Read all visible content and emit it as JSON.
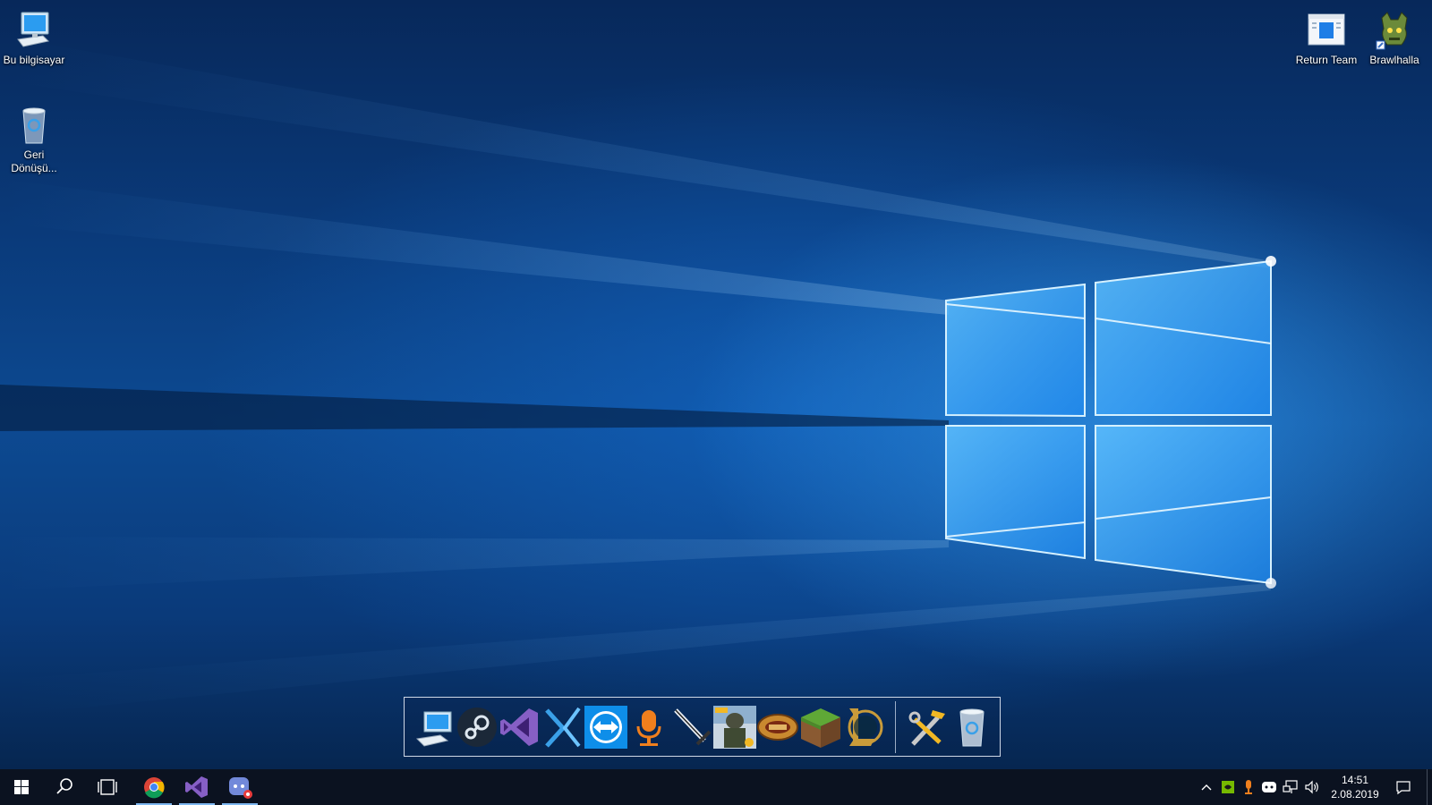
{
  "desktop": {
    "icons_left": [
      {
        "label": "Bu bilgisayar",
        "icon": "this-pc-icon"
      },
      {
        "label": "Geri Dönüşü...",
        "icon": "recycle-bin-icon"
      }
    ],
    "icons_right": [
      {
        "label": "Return Team",
        "icon": "window-app-icon"
      },
      {
        "label": "Brawlhalla",
        "icon": "brawlhalla-icon"
      }
    ]
  },
  "dock": {
    "items": [
      {
        "icon": "computer-icon"
      },
      {
        "icon": "steam-icon"
      },
      {
        "icon": "visual-studio-icon"
      },
      {
        "icon": "xamarin-icon"
      },
      {
        "icon": "teamviewer-icon"
      },
      {
        "icon": "microphone-icon"
      },
      {
        "icon": "sword-icon"
      },
      {
        "icon": "pubg-icon"
      },
      {
        "icon": "game-ring-icon"
      },
      {
        "icon": "minecraft-icon"
      },
      {
        "icon": "league-of-legends-icon"
      }
    ],
    "utility_items": [
      {
        "icon": "tools-icon"
      },
      {
        "icon": "trash-icon"
      }
    ]
  },
  "taskbar": {
    "start_icon": "windows-start-icon",
    "search_icon": "search-icon",
    "task_view_icon": "task-view-icon",
    "pinned": [
      {
        "icon": "chrome-icon",
        "active": true
      },
      {
        "icon": "visual-studio-icon",
        "active": true
      },
      {
        "icon": "discord-icon",
        "active": true
      }
    ],
    "tray": [
      {
        "icon": "chevron-up-icon"
      },
      {
        "icon": "nvidia-icon"
      },
      {
        "icon": "microphone-icon"
      },
      {
        "icon": "discord-icon"
      },
      {
        "icon": "network-icon"
      },
      {
        "icon": "volume-icon"
      }
    ],
    "clock": {
      "time": "14:51",
      "date": "2.08.2019"
    },
    "notification_icon": "action-center-icon"
  },
  "colors": {
    "accent": "#1e88ff",
    "taskbar": "#0b1220"
  }
}
